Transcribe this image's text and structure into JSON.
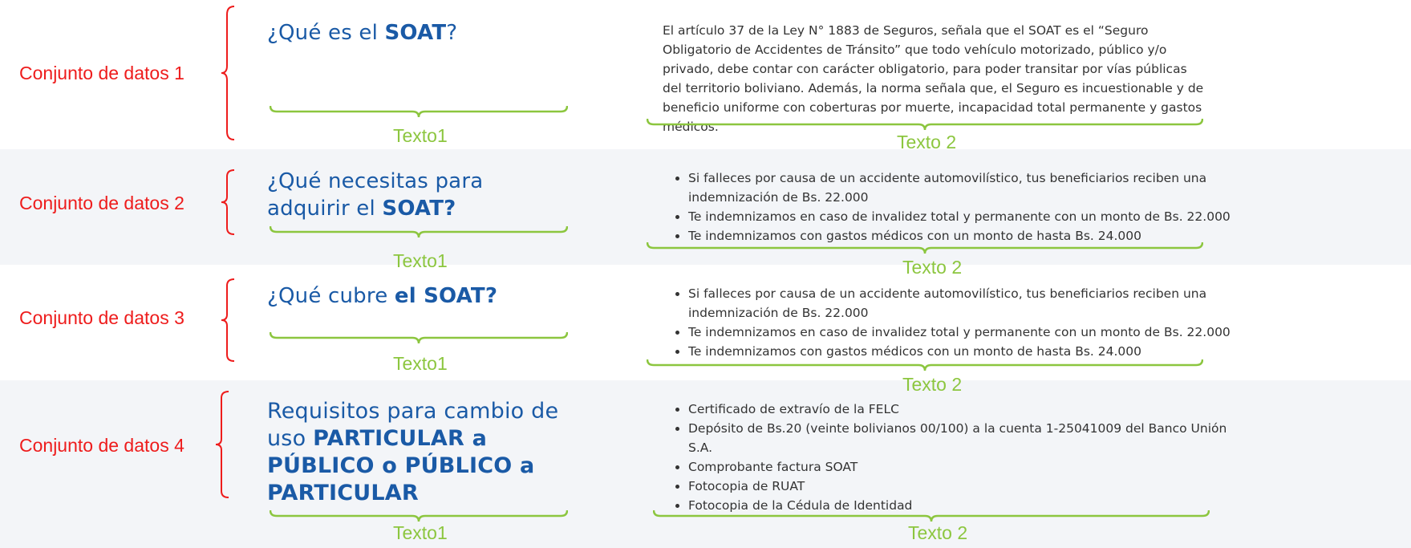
{
  "colors": {
    "annotation_red": "#ee1c1c",
    "annotation_green": "#8cc63f",
    "heading_blue": "#1a5aa6",
    "band_gray": "#f3f5f8"
  },
  "sections": [
    {
      "annotation": "Conjunto de datos 1",
      "heading_pre": "¿Qué es el ",
      "heading_bold": "SOAT",
      "heading_post": "?",
      "body": "El artículo 37 de la Ley N° 1883 de Seguros, señala que el SOAT es el “Seguro Obligatorio de Accidentes de Tránsito” que todo vehículo motorizado, público y/o privado, debe contar con carácter obligatorio, para poder transitar por vías públicas del territorio boliviano. Además, la norma señala que, el Seguro es incuestionable y de beneficio uniforme con coberturas por muerte, incapacidad total permanente y gastos médicos.",
      "tag1": "Texto1",
      "tag2": "Texto 2"
    },
    {
      "annotation": "Conjunto de datos 2",
      "heading_pre": "¿Qué necesitas para adquirir el ",
      "heading_bold": "SOAT?",
      "heading_post": "",
      "items": [
        "Si falleces por causa de un accidente automovilístico, tus beneficiarios reciben una indemnización de Bs. 22.000",
        "Te indemnizamos en caso de invalidez total y permanente con un monto de Bs. 22.000",
        "Te indemnizamos con gastos médicos con un monto de hasta Bs. 24.000"
      ],
      "tag1": "Texto1",
      "tag2": "Texto 2"
    },
    {
      "annotation": "Conjunto de datos 3",
      "heading_pre": "¿Qué cubre ",
      "heading_bold": "el SOAT?",
      "heading_post": "",
      "items": [
        "Si falleces por causa de un accidente automovilístico, tus beneficiarios reciben una indemnización de Bs. 22.000",
        "Te indemnizamos en caso de invalidez total y permanente con un monto de Bs. 22.000",
        "Te indemnizamos con gastos médicos con un monto de hasta Bs. 24.000"
      ],
      "tag1": "Texto1",
      "tag2": "Texto 2"
    },
    {
      "annotation": "Conjunto de datos 4",
      "heading_pre": "Requisitos para cambio de uso ",
      "heading_bold": "PARTICULAR a PÚBLICO o PÚBLICO a PARTICULAR",
      "heading_post": "",
      "items": [
        "Certificado de extravío de la FELC",
        "Depósito de Bs.20 (veinte bolivianos 00/100) a la cuenta 1-25041009 del Banco Unión S.A.",
        "Comprobante factura SOAT",
        "Fotocopia de RUAT",
        "Fotocopia de la Cédula de Identidad"
      ],
      "tag1": "Texto1",
      "tag2": "Texto 2"
    }
  ]
}
